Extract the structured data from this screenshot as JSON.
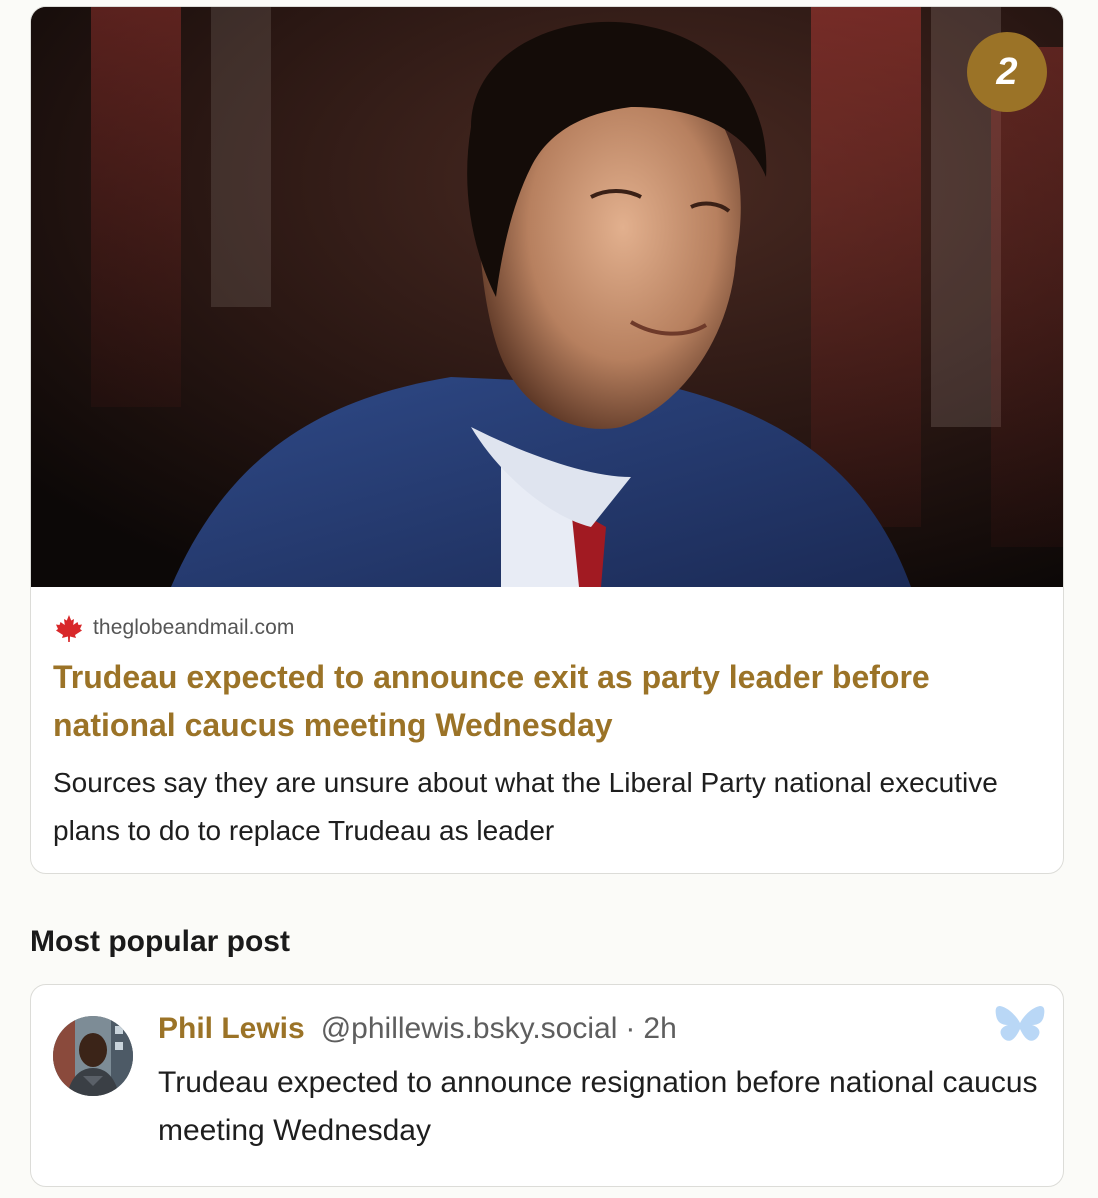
{
  "article": {
    "rank": "2",
    "source_domain": "theglobeandmail.com",
    "title": "Trudeau expected to announce exit as party leader before national caucus meeting Wednesday",
    "description": "Sources say they are unsure about what the Liberal Party national executive plans to do to replace Trudeau as leader",
    "source_icon": "maple-leaf-icon"
  },
  "popular": {
    "heading": "Most popular post",
    "post": {
      "author_name": "Phil Lewis",
      "handle": "@phillewis.bsky.social",
      "separator": "·",
      "time": "2h",
      "text": "Trudeau expected to announce resignation before national caucus meeting Wednesday",
      "platform_icon": "bluesky-butterfly-icon"
    }
  },
  "colors": {
    "accent": "#9b7327",
    "bluesky": "#b9d7f6",
    "maple": "#d8282a"
  }
}
